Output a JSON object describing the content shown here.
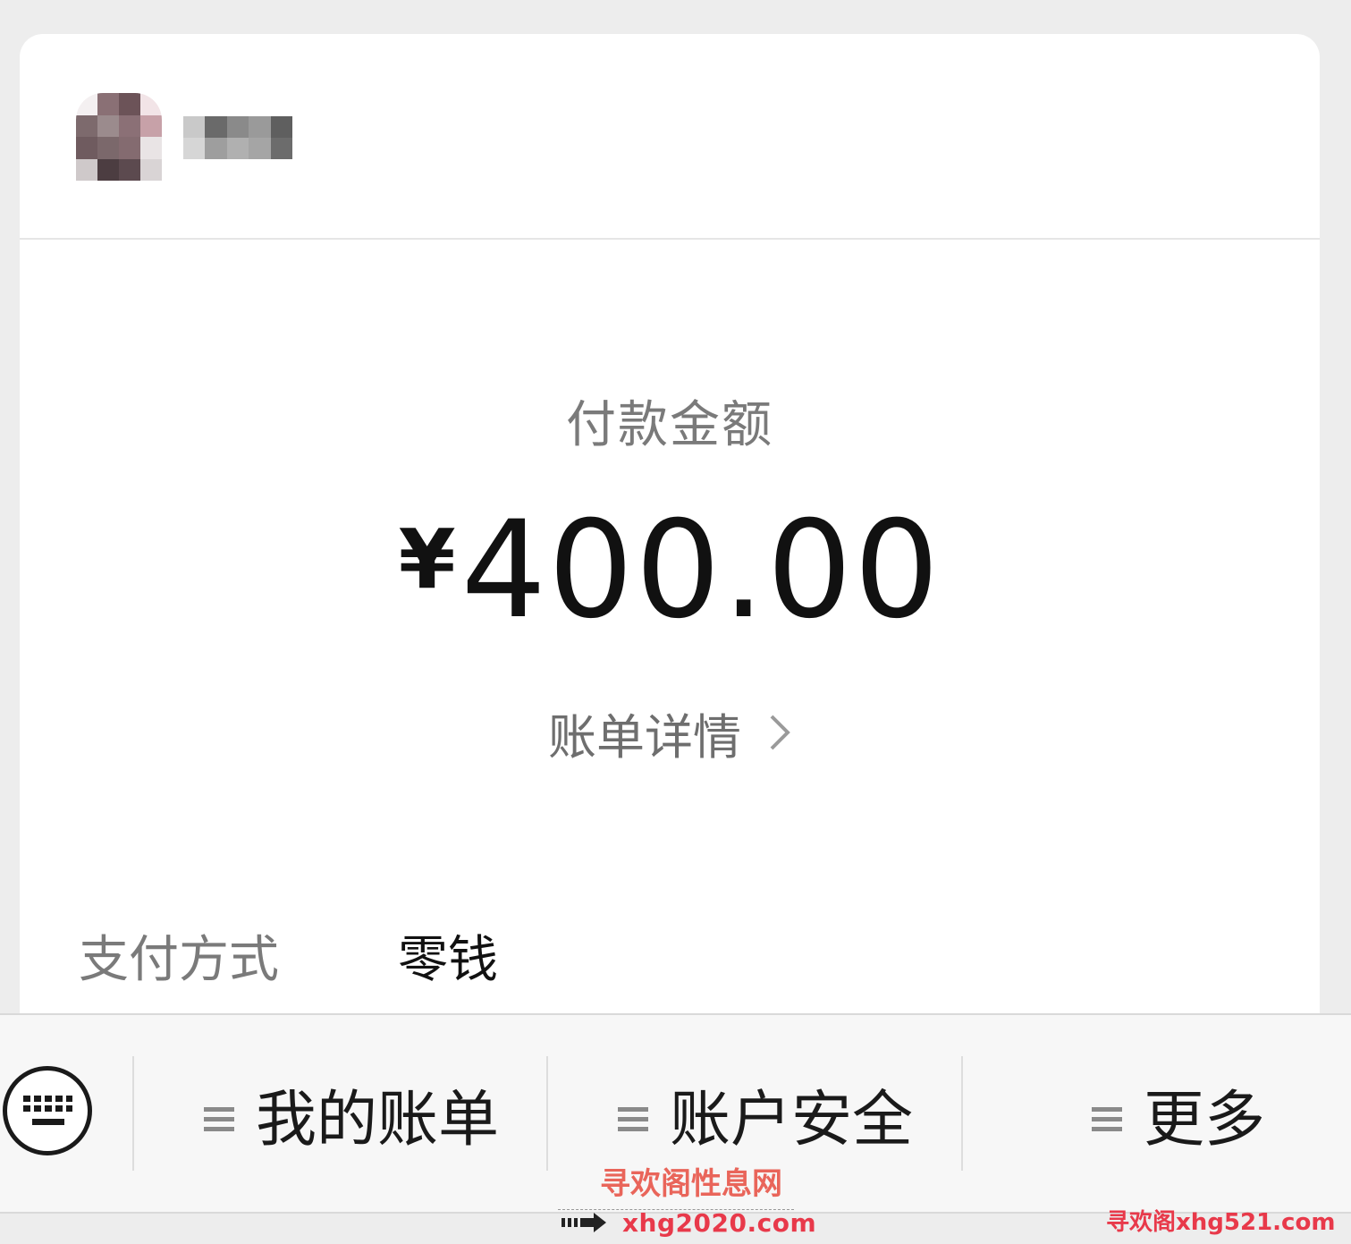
{
  "payment": {
    "amount_label": "付款金额",
    "currency_symbol": "¥",
    "amount": "400.00",
    "bill_detail_link": "账单详情",
    "method_label": "支付方式",
    "method_value": "零钱"
  },
  "bottom_menu": {
    "items": [
      {
        "label": "我的账单",
        "icon": "menu-icon"
      },
      {
        "label": "账户安全",
        "icon": "menu-icon"
      },
      {
        "label": "更多",
        "icon": "menu-icon"
      }
    ],
    "keyboard_icon": "keyboard-icon"
  },
  "watermark": {
    "site_name": "寻欢阁性息网",
    "site_url": "xhg2020.com",
    "corner_text": "寻欢阁xhg521.com"
  },
  "colors": {
    "background": "#ededed",
    "card": "#ffffff",
    "label_gray": "#7a7a7a",
    "amount_black": "#111111",
    "watermark_red": "#e8394a"
  }
}
